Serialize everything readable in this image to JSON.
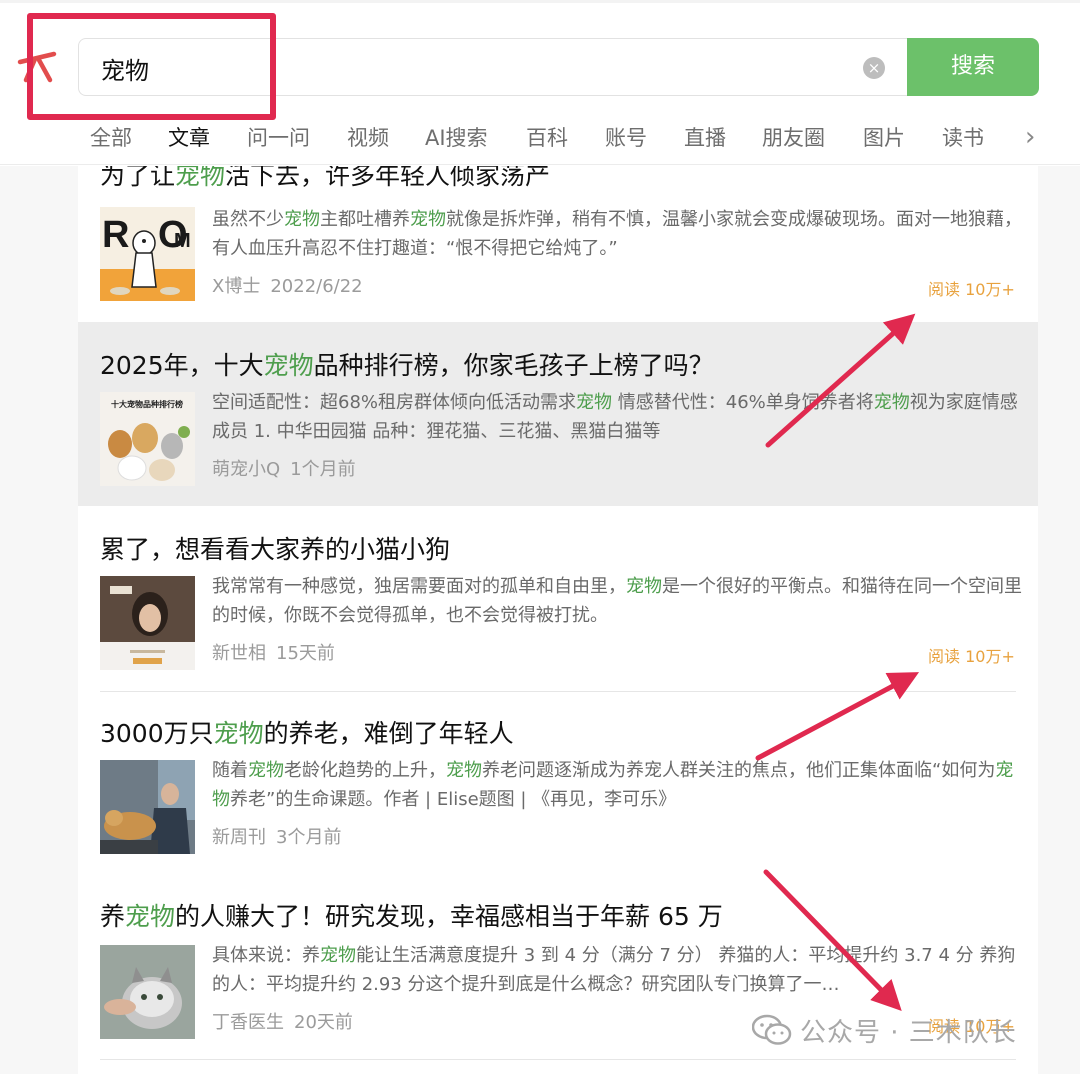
{
  "search": {
    "query": "宠物",
    "button_label": "搜索",
    "clear_label": "×"
  },
  "tabs": [
    {
      "label": "全部"
    },
    {
      "label": "文章",
      "active": true
    },
    {
      "label": "问一问"
    },
    {
      "label": "视频"
    },
    {
      "label": "AI搜索"
    },
    {
      "label": "百科"
    },
    {
      "label": "账号"
    },
    {
      "label": "直播"
    },
    {
      "label": "朋友圈"
    },
    {
      "label": "图片"
    },
    {
      "label": "读书"
    }
  ],
  "tabs_more": "›",
  "results": [
    {
      "title_pre": "为了让",
      "title_kw": "宠物",
      "title_post": "活下去，许多年轻人倾家荡产",
      "desc_html": "虽然不少<span class=\"kw\">宠物</span>主都吐槽养<span class=\"kw\">宠物</span>就像是拆炸弹，稍有不慎，温馨小家就会变成爆破现场。面对一地狼藉，有人血压升高忍不住打趣道：“恨不得把它给炖了。”",
      "author": "X博士",
      "date": "2022/6/22",
      "read": "阅读 10万+",
      "thumb": "rmo"
    },
    {
      "title_pre": "2025年，十大",
      "title_kw": "宠物",
      "title_post": "品种排行榜，你家毛孩子上榜了吗？",
      "desc_html": "空间适配性：超68%租房群体倾向低活动需求<span class=\"kw\">宠物</span> 情感替代性：46%单身饲养者将<span class=\"kw\">宠物</span>视为家庭情感成员 1. 中华田园猫 品种：狸花猫、三花猫、黑猫白猫等",
      "author": "萌宠小Q",
      "date": "1个月前",
      "read": "",
      "thumb": "pets",
      "thumb_caption": "十大宠物品种排行榜"
    },
    {
      "title_pre": "累了，想看看大家养的小猫小狗",
      "title_kw": "",
      "title_post": "",
      "desc_html": "我常常有一种感觉，独居需要面对的孤单和自由里，<span class=\"kw\">宠物</span>是一个很好的平衡点。和猫待在同一个空间里的时候，你既不会觉得孤单，也不会觉得被打扰。",
      "author": "新世相",
      "date": "15天前",
      "read": "阅读 10万+",
      "thumb": "portrait"
    },
    {
      "title_pre": "3000万只",
      "title_kw": "宠物",
      "title_post": "的养老，难倒了年轻人",
      "desc_html": "随着<span class=\"kw\">宠物</span>老龄化趋势的上升，<span class=\"kw\">宠物</span>养老问题逐渐成为养宠人群关注的焦点，他们正集体面临“如何为<span class=\"kw\">宠物</span>养老”的生命课题。作者 | Elise题图 | 《再见，李可乐》",
      "author": "新周刊",
      "date": "3个月前",
      "read": "",
      "thumb": "vet"
    },
    {
      "title_pre": "养",
      "title_kw": "宠物",
      "title_post": "的人赚大了！研究发现，幸福感相当于年薪 65 万",
      "desc_html": "具体来说：养<span class=\"kw\">宠物</span>能让生活满意度提升 3 到 4 分（满分 7 分） 养猫的人：平均提升约 3.7 4 分 养狗的人：平均提升约 2.93 分这个提升到底是什么概念？研究团队专门换算了一…",
      "author": "丁香医生",
      "date": "20天前",
      "read": "阅读 10万+",
      "thumb": "cat"
    }
  ],
  "watermark": {
    "text": "公众号 · 三木队长"
  },
  "colors": {
    "accent_green": "#6cc16a",
    "keyword_green": "#4e9e4d",
    "annotation_red": "#e0294f",
    "read_orange": "#e8a23e"
  }
}
